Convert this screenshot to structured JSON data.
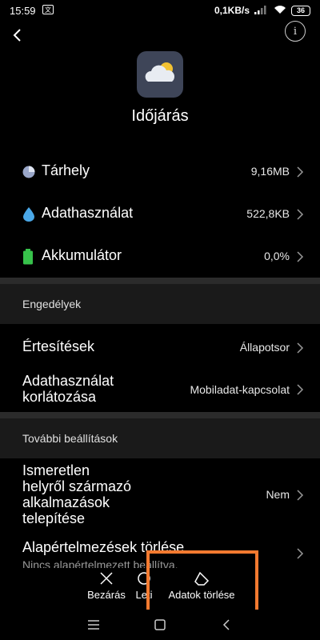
{
  "status_bar": {
    "time": "15:59",
    "speed": "0,1KB/s",
    "battery": "36"
  },
  "app": {
    "name": "Időjárás"
  },
  "storage_rows": [
    {
      "label": "Tárhely",
      "value": "9,16MB",
      "icon": "pie-chart-icon"
    },
    {
      "label": "Adathasználat",
      "value": "522,8KB",
      "icon": "water-drop-icon"
    },
    {
      "label": "Akkumulátor",
      "value": "0,0%",
      "icon": "battery-icon"
    }
  ],
  "permissions": {
    "header": "Engedélyek",
    "rows": [
      {
        "label": "Értesítések",
        "value": "Állapotsor"
      },
      {
        "label_line1": "Adathasználat",
        "label_line2": "korlátozása",
        "value": "Mobiladat-kapcsolat"
      }
    ]
  },
  "more_settings": {
    "header": "További beállítások",
    "unknown_sources": {
      "line1": "Ismeretlen",
      "line2": "helyről származó",
      "line3": "alkalmazások",
      "line4": "telepítése",
      "value": "Nem"
    },
    "defaults": {
      "label": "Alapértelmezések törlése",
      "sub": "Nincs alapértelmezett beállítva."
    }
  },
  "actions": {
    "close": "Bezárás",
    "uninstall_partial": "Leti",
    "clear_data": "Adatok törlése"
  },
  "colors": {
    "highlight": "#f47a30",
    "battery_green": "#37c24b",
    "drop_blue": "#4aa8e8"
  }
}
